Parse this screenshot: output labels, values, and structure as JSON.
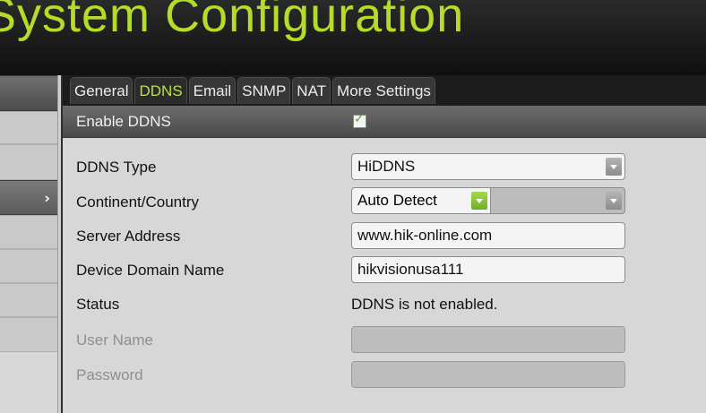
{
  "window": {
    "title": "System Configuration"
  },
  "tabs": [
    {
      "label": "General",
      "active": false
    },
    {
      "label": "DDNS",
      "active": true
    },
    {
      "label": "Email",
      "active": false
    },
    {
      "label": "SNMP",
      "active": false
    },
    {
      "label": "NAT",
      "active": false
    },
    {
      "label": "More Settings",
      "active": false
    }
  ],
  "sidebar": {
    "selected_chevron": "›"
  },
  "form": {
    "enable_ddns": {
      "label": "Enable DDNS",
      "checked": true
    },
    "ddns_type": {
      "label": "DDNS Type",
      "value": "HiDDNS"
    },
    "continent_country": {
      "label": "Continent/Country",
      "value": "Auto Detect",
      "secondary_value": ""
    },
    "server_address": {
      "label": "Server Address",
      "value": "www.hik-online.com"
    },
    "device_domain_name": {
      "label": "Device Domain Name",
      "value": "hikvisionusa111"
    },
    "status": {
      "label": "Status",
      "value": "DDNS is not enabled."
    },
    "user_name": {
      "label": "User Name",
      "value": "",
      "disabled": true
    },
    "password": {
      "label": "Password",
      "value": "",
      "disabled": true
    }
  },
  "colors": {
    "accent": "#b5dc27",
    "active_tab_text": "#b8e04a",
    "checkmark": "#58a82a"
  },
  "icons": {
    "checkbox": "checkmark-icon",
    "dropdown": "chevron-down-icon",
    "sidebar_arrow": "chevron-right-icon"
  }
}
